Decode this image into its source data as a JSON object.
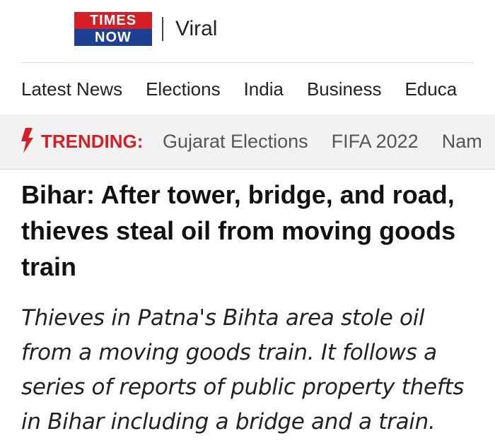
{
  "header": {
    "logo": {
      "line1": "TIMES",
      "line2": "NOW",
      "top_color": "#d41f26",
      "bottom_color": "#1d3f94"
    },
    "section": "Viral"
  },
  "nav": {
    "items": [
      "Latest News",
      "Elections",
      "India",
      "Business",
      "Educa"
    ]
  },
  "trending": {
    "icon": "lightning-bolt-icon",
    "label": "TRENDING:",
    "items": [
      "Gujarat Elections",
      "FIFA 2022",
      "Nam"
    ],
    "accent": "#d41f26"
  },
  "article": {
    "headline": "Bihar: After tower, bridge, and road, thieves steal oil from moving goods train",
    "summary": "Thieves in Patna's Bihta area stole oil from a moving goods train. It follows a series of reports of public property thefts in Bihar including a bridge and a train."
  }
}
